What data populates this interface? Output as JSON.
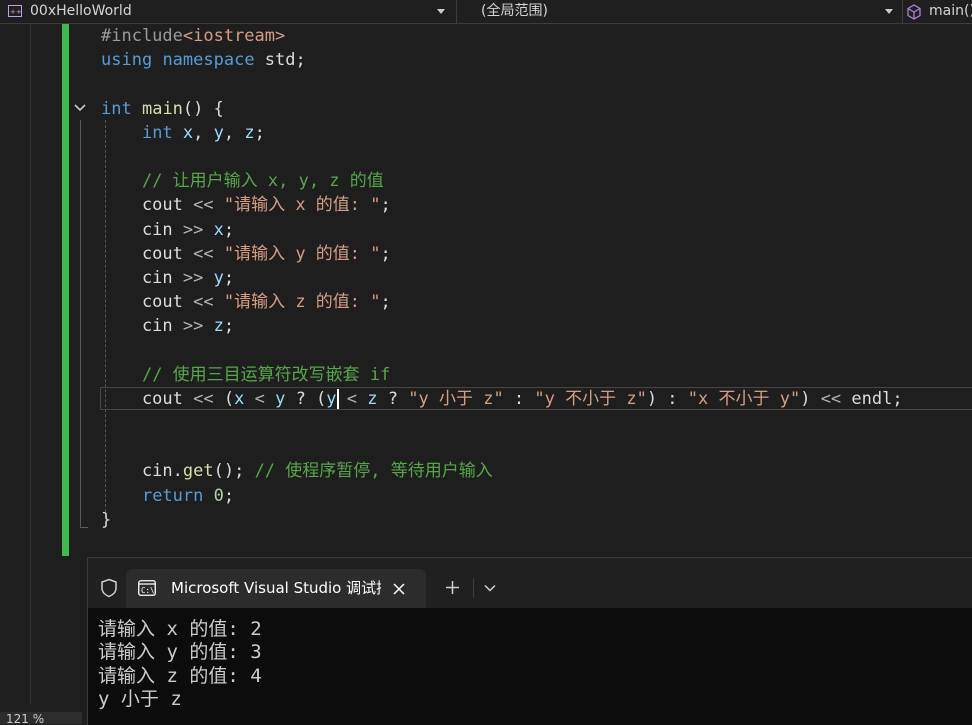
{
  "navbar": {
    "project": "00xHelloWorld",
    "scope": "(全局范围)",
    "member": "main()"
  },
  "editor": {
    "code_lines": [
      [
        {
          "t": "pp",
          "v": "#include"
        },
        {
          "t": "inc",
          "v": "<iostream>"
        }
      ],
      [
        {
          "t": "kw",
          "v": "using"
        },
        {
          "t": "p",
          "v": " "
        },
        {
          "t": "kw",
          "v": "namespace"
        },
        {
          "t": "p",
          "v": " std;"
        }
      ],
      [],
      [
        {
          "t": "kw",
          "v": "int"
        },
        {
          "t": "p",
          "v": " "
        },
        {
          "t": "fn",
          "v": "main"
        },
        {
          "t": "p",
          "v": "() {"
        }
      ],
      [
        {
          "t": "p",
          "v": "    "
        },
        {
          "t": "kw",
          "v": "int"
        },
        {
          "t": "p",
          "v": " "
        },
        {
          "t": "var",
          "v": "x"
        },
        {
          "t": "p",
          "v": ", "
        },
        {
          "t": "var",
          "v": "y"
        },
        {
          "t": "p",
          "v": ", "
        },
        {
          "t": "var",
          "v": "z"
        },
        {
          "t": "p",
          "v": ";"
        }
      ],
      [],
      [
        {
          "t": "p",
          "v": "    "
        },
        {
          "t": "cmt",
          "v": "// 让用户输入 x, y, z 的值"
        }
      ],
      [
        {
          "t": "p",
          "v": "    cout "
        },
        {
          "t": "op",
          "v": "<<"
        },
        {
          "t": "p",
          "v": " "
        },
        {
          "t": "str",
          "v": "\"请输入 x 的值: \""
        },
        {
          "t": "p",
          "v": ";"
        }
      ],
      [
        {
          "t": "p",
          "v": "    cin "
        },
        {
          "t": "op",
          "v": ">>"
        },
        {
          "t": "p",
          "v": " "
        },
        {
          "t": "var",
          "v": "x"
        },
        {
          "t": "p",
          "v": ";"
        }
      ],
      [
        {
          "t": "p",
          "v": "    cout "
        },
        {
          "t": "op",
          "v": "<<"
        },
        {
          "t": "p",
          "v": " "
        },
        {
          "t": "str",
          "v": "\"请输入 y 的值: \""
        },
        {
          "t": "p",
          "v": ";"
        }
      ],
      [
        {
          "t": "p",
          "v": "    cin "
        },
        {
          "t": "op",
          "v": ">>"
        },
        {
          "t": "p",
          "v": " "
        },
        {
          "t": "var",
          "v": "y"
        },
        {
          "t": "p",
          "v": ";"
        }
      ],
      [
        {
          "t": "p",
          "v": "    cout "
        },
        {
          "t": "op",
          "v": "<<"
        },
        {
          "t": "p",
          "v": " "
        },
        {
          "t": "str",
          "v": "\"请输入 z 的值: \""
        },
        {
          "t": "p",
          "v": ";"
        }
      ],
      [
        {
          "t": "p",
          "v": "    cin "
        },
        {
          "t": "op",
          "v": ">>"
        },
        {
          "t": "p",
          "v": " "
        },
        {
          "t": "var",
          "v": "z"
        },
        {
          "t": "p",
          "v": ";"
        }
      ],
      [],
      [
        {
          "t": "p",
          "v": "    "
        },
        {
          "t": "cmt",
          "v": "// 使用三目运算符改写嵌套 if"
        }
      ],
      [
        {
          "t": "p",
          "v": "    cout "
        },
        {
          "t": "op",
          "v": "<<"
        },
        {
          "t": "p",
          "v": " ("
        },
        {
          "t": "var",
          "v": "x"
        },
        {
          "t": "p",
          "v": " "
        },
        {
          "t": "op",
          "v": "<"
        },
        {
          "t": "p",
          "v": " "
        },
        {
          "t": "var",
          "v": "y"
        },
        {
          "t": "p",
          "v": " ? ("
        },
        {
          "t": "var",
          "v": "y"
        },
        {
          "t": "p",
          "v": " "
        },
        {
          "t": "op",
          "v": "<"
        },
        {
          "t": "p",
          "v": " "
        },
        {
          "t": "var",
          "v": "z"
        },
        {
          "t": "p",
          "v": " ? "
        },
        {
          "t": "str",
          "v": "\"y 小于 z\""
        },
        {
          "t": "p",
          "v": " : "
        },
        {
          "t": "str",
          "v": "\"y 不小于 z\""
        },
        {
          "t": "p",
          "v": ") : "
        },
        {
          "t": "str",
          "v": "\"x 不小于 y\""
        },
        {
          "t": "p",
          "v": ") "
        },
        {
          "t": "op",
          "v": "<<"
        },
        {
          "t": "p",
          "v": " endl;"
        }
      ],
      [],
      [],
      [
        {
          "t": "p",
          "v": "    cin."
        },
        {
          "t": "fn",
          "v": "get"
        },
        {
          "t": "p",
          "v": "(); "
        },
        {
          "t": "cmt",
          "v": "// 使程序暂停, 等待用户输入"
        }
      ],
      [
        {
          "t": "p",
          "v": "    "
        },
        {
          "t": "kw",
          "v": "return"
        },
        {
          "t": "p",
          "v": " "
        },
        {
          "t": "num",
          "v": "0"
        },
        {
          "t": "p",
          "v": ";"
        }
      ],
      [
        {
          "t": "p",
          "v": "}"
        }
      ]
    ]
  },
  "zoom": "121 %",
  "terminal": {
    "tab_title": "Microsoft Visual Studio 调试控",
    "output_lines": [
      "请输入 x 的值: 2",
      "请输入 y 的值: 3",
      "请输入 z 的值: 4",
      "y 小于 z"
    ]
  }
}
